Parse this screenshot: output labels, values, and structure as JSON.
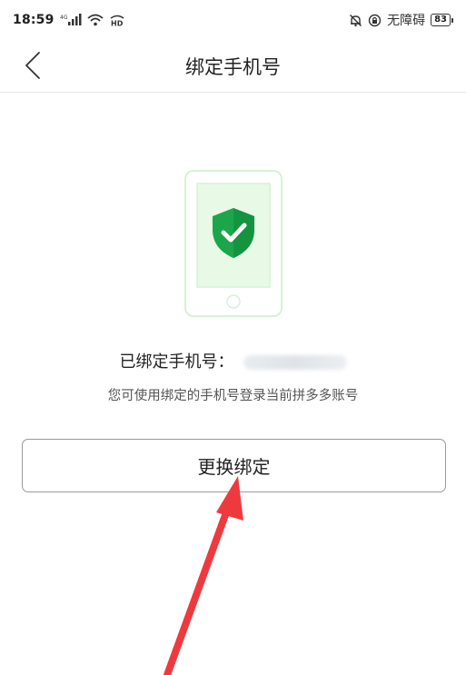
{
  "status_bar": {
    "time": "18:59",
    "network_label": "4G",
    "hd_label": "HD",
    "accessibility": "无障碍",
    "battery": "83"
  },
  "header": {
    "title": "绑定手机号"
  },
  "info": {
    "bound_label": "已绑定手机号：",
    "hint": "您可使用绑定的手机号登录当前拼多多账号"
  },
  "actions": {
    "change_binding": "更换绑定"
  },
  "colors": {
    "shield_green": "#1ca64a",
    "phone_outline": "#d6f2d6",
    "screen_fill": "#e8f9e6",
    "arrow_red": "#ee3a3f"
  }
}
